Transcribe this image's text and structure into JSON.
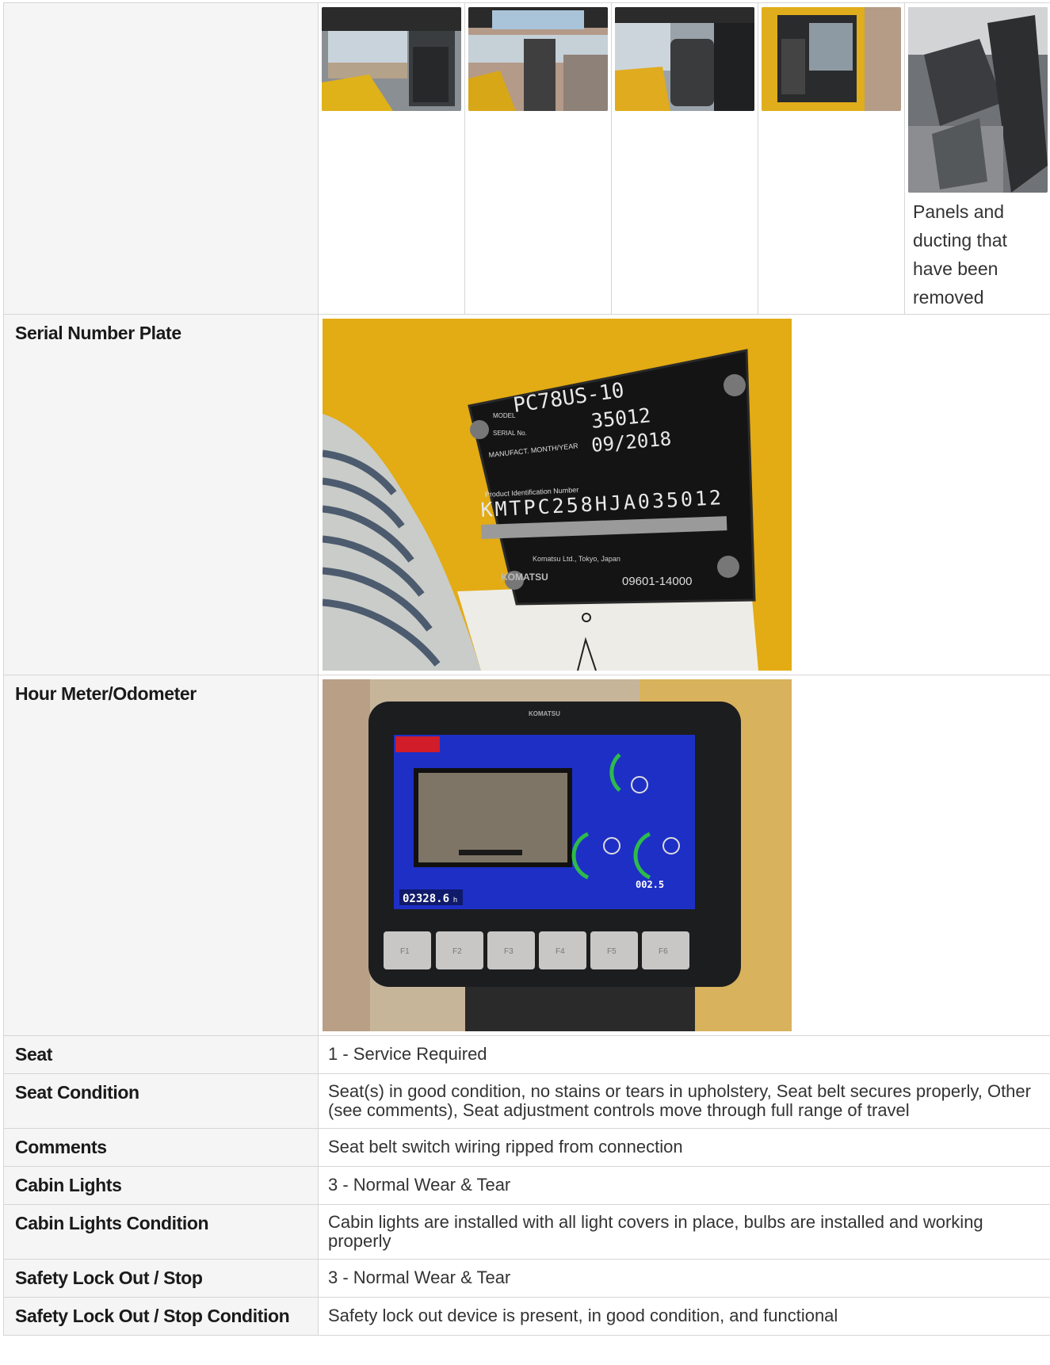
{
  "photo_strip": {
    "thumbnails": [
      {
        "icon": "cabin-interior-photo"
      },
      {
        "icon": "cabin-roof-photo"
      },
      {
        "icon": "operator-seat-photo"
      },
      {
        "icon": "cabin-door-photo"
      },
      {
        "icon": "removed-panels-photo",
        "caption": "Panels and ducting that have been removed"
      }
    ]
  },
  "serial_plate": {
    "label": "Serial Number Plate",
    "plate": {
      "model": "PC78US-10",
      "serial": "35012",
      "manufact_date": "09/2018",
      "model_caption": "MODEL",
      "serial_caption": "SERIAL No.",
      "manufact_caption": "MANUFACT. MONTH/YEAR",
      "pin_caption": "Product Identification Number",
      "pin": "KMTPC258HJA035012",
      "maker": "Komatsu Ltd., Tokyo, Japan",
      "brand": "KOMATSU",
      "part_no": "09601-14000"
    }
  },
  "hour_meter": {
    "label": "Hour Meter/Odometer",
    "display": {
      "brand": "KOMATSU",
      "hours": "02328.6",
      "hours_unit": "h",
      "flow": "002.5",
      "keys": [
        "F1",
        "F2",
        "F3",
        "F4",
        "F5",
        "F6"
      ]
    }
  },
  "rows": [
    {
      "label": "Seat",
      "value": "1 - Service Required"
    },
    {
      "label": "Seat Condition",
      "value": "Seat(s) in good condition, no stains or tears in upholstery, Seat belt secures properly, Other (see comments), Seat adjustment controls move through full range of travel"
    },
    {
      "label": "Comments",
      "value": "Seat belt switch wiring ripped from connection"
    },
    {
      "label": "Cabin Lights",
      "value": "3 - Normal Wear & Tear"
    },
    {
      "label": "Cabin Lights Condition",
      "value": "Cabin lights are installed with all light covers in place, bulbs are installed and working properly"
    },
    {
      "label": "Safety Lock Out / Stop",
      "value": "3 - Normal Wear & Tear"
    },
    {
      "label": "Safety Lock Out / Stop Condition",
      "value": "Safety lock out device is present, in good condition, and functional"
    }
  ]
}
